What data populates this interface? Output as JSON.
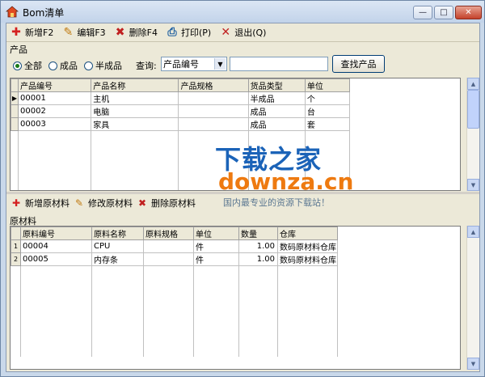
{
  "window": {
    "title": "Bom清单",
    "min_symbol": "—",
    "max_symbol": "□",
    "close_symbol": "✕"
  },
  "toolbar": [
    {
      "label": "新增F2",
      "icon": "add-icon",
      "color": "#d42020",
      "glyph": "✚"
    },
    {
      "label": "编辑F3",
      "icon": "edit-icon",
      "color": "#c07a10",
      "glyph": "✎"
    },
    {
      "label": "删除F4",
      "icon": "delete-icon",
      "color": "#c02020",
      "glyph": "✖"
    },
    {
      "label": "打印(P)",
      "icon": "print-icon",
      "color": "#2060a0",
      "glyph": "⎙"
    },
    {
      "label": "退出(Q)",
      "icon": "exit-icon",
      "color": "#c02020",
      "glyph": "✕"
    }
  ],
  "product": {
    "section_label": "产品",
    "filters": [
      {
        "label": "全部",
        "checked": true
      },
      {
        "label": "成品",
        "checked": false
      },
      {
        "label": "半成品",
        "checked": false
      }
    ],
    "query_label": "查询:",
    "query_field": "产品编号",
    "search_value": "",
    "search_button": "查找产品",
    "columns": [
      "产品编号",
      "产品名称",
      "产品规格",
      "货品类型",
      "单位"
    ],
    "rows": [
      {
        "code": "00001",
        "name": "主机",
        "spec": "",
        "type": "半成品",
        "unit": "个"
      },
      {
        "code": "00002",
        "name": "电脑",
        "spec": "",
        "type": "成品",
        "unit": "台"
      },
      {
        "code": "00003",
        "name": "家具",
        "spec": "",
        "type": "成品",
        "unit": "套"
      }
    ],
    "current_row_marker": "▶"
  },
  "material_toolbar": [
    {
      "label": "新增原材料",
      "icon": "add-material-icon",
      "color": "#d42020",
      "glyph": "✚"
    },
    {
      "label": "修改原材料",
      "icon": "edit-material-icon",
      "color": "#c07a10",
      "glyph": "✎"
    },
    {
      "label": "删除原材料",
      "icon": "delete-material-icon",
      "color": "#c02020",
      "glyph": "✖"
    }
  ],
  "material": {
    "section_label": "原材料",
    "columns": [
      "原料编号",
      "原料名称",
      "原料规格",
      "单位",
      "数量",
      "仓库"
    ],
    "rows": [
      {
        "index": "1",
        "code": "00004",
        "name": "CPU",
        "spec": "",
        "unit": "件",
        "qty": "1.00",
        "warehouse": "数码原材料仓库"
      },
      {
        "index": "2",
        "code": "00005",
        "name": "内存条",
        "spec": "",
        "unit": "件",
        "qty": "1.00",
        "warehouse": "数码原材料仓库"
      }
    ]
  },
  "watermark": {
    "title": "下载之家",
    "url": "downza.cn",
    "tagline": "国内最专业的资源下载站！"
  },
  "colors": {
    "accent_blue": "#1b63b8",
    "accent_orange": "#ee7a10",
    "window_frame": "#c9d8ea"
  }
}
